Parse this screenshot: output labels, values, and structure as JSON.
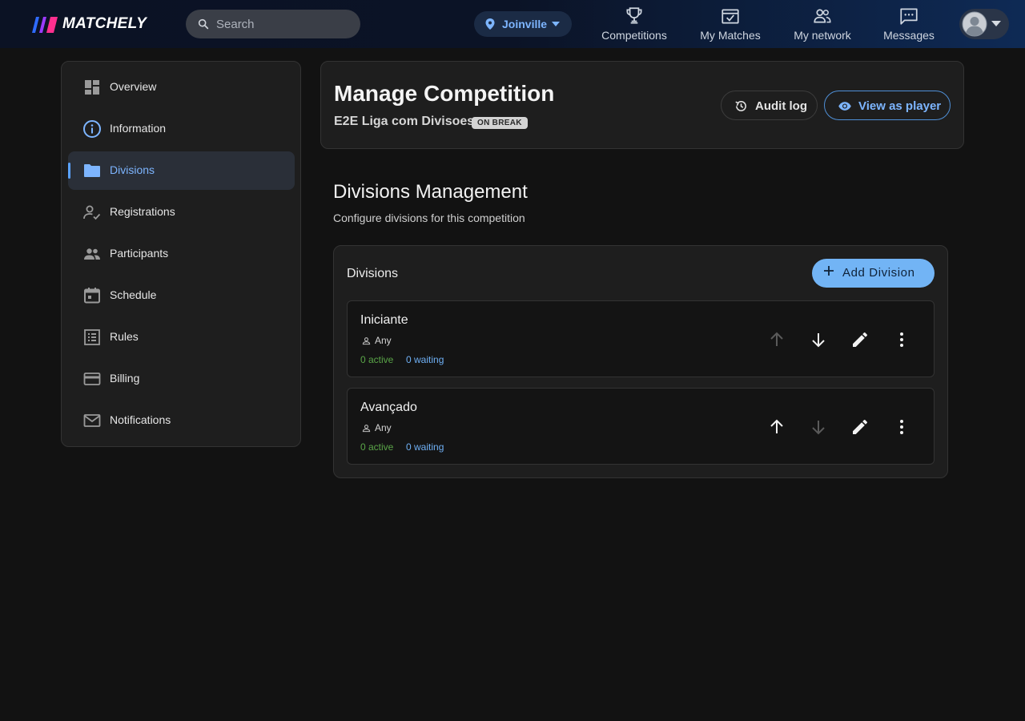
{
  "app": {
    "name": "MATCHELY"
  },
  "search": {
    "placeholder": "Search"
  },
  "location": {
    "label": "Joinville"
  },
  "nav": [
    {
      "label": "Competitions",
      "icon": "trophy-icon"
    },
    {
      "label": "My Matches",
      "icon": "calendar-check-icon"
    },
    {
      "label": "My network",
      "icon": "people-icon"
    },
    {
      "label": "Messages",
      "icon": "chat-icon"
    }
  ],
  "sidebar": {
    "items": [
      {
        "label": "Overview",
        "icon": "dashboard-icon",
        "active": false
      },
      {
        "label": "Information",
        "icon": "info-icon",
        "active": false
      },
      {
        "label": "Divisions",
        "icon": "folder-icon",
        "active": true
      },
      {
        "label": "Registrations",
        "icon": "person-check-icon",
        "active": false
      },
      {
        "label": "Participants",
        "icon": "group-icon",
        "active": false
      },
      {
        "label": "Schedule",
        "icon": "calendar-icon",
        "active": false
      },
      {
        "label": "Rules",
        "icon": "list-icon",
        "active": false
      },
      {
        "label": "Billing",
        "icon": "credit-card-icon",
        "active": false
      },
      {
        "label": "Notifications",
        "icon": "mail-icon",
        "active": false
      }
    ]
  },
  "header": {
    "title": "Manage Competition",
    "competition_name": "E2E Liga com Divisoes",
    "status_badge": "ON BREAK",
    "audit_label": "Audit log",
    "view_as_player_label": "View as player"
  },
  "section": {
    "title": "Divisions Management",
    "subtitle": "Configure divisions for this competition"
  },
  "divisions_card": {
    "title": "Divisions",
    "add_label": "Add Division",
    "rows": [
      {
        "name": "Iniciante",
        "gender": "Any",
        "active": "0 active",
        "waiting": "0 waiting",
        "can_move_up": false,
        "can_move_down": true
      },
      {
        "name": "Avançado",
        "gender": "Any",
        "active": "0 active",
        "waiting": "0 waiting",
        "can_move_up": true,
        "can_move_down": false
      }
    ]
  },
  "colors": {
    "accent": "#72b4f5",
    "active_green": "#5aa548",
    "waiting_blue": "#6fb0f5",
    "background": "#121212"
  }
}
